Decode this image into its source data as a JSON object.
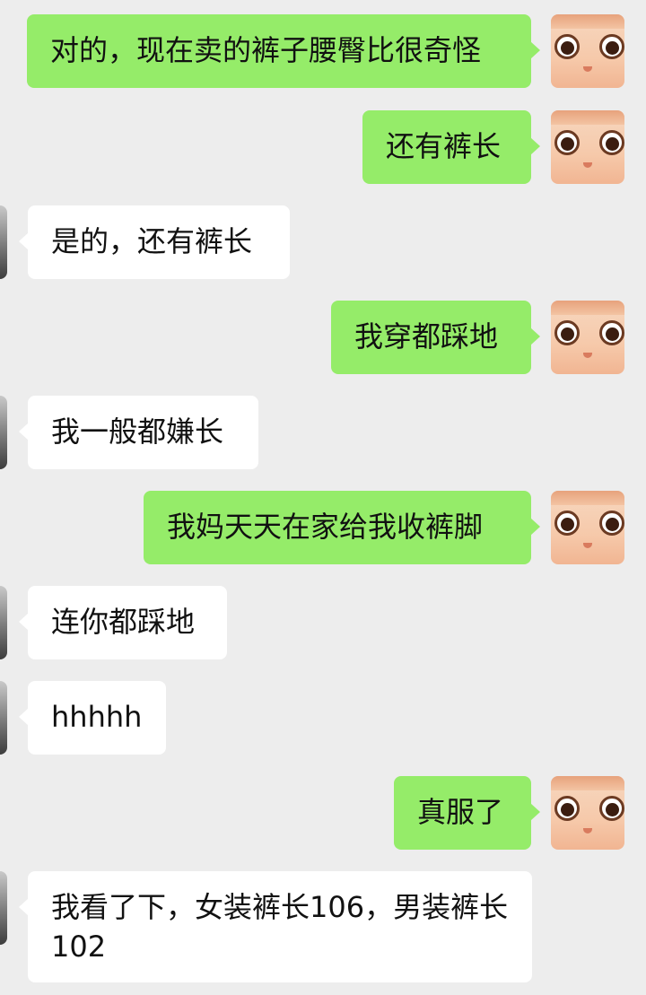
{
  "chat": {
    "messages": [
      {
        "side": "me",
        "text": "对的，现在卖的裤子腰臀比很奇怪"
      },
      {
        "side": "me",
        "text": "还有裤长"
      },
      {
        "side": "them",
        "text": "是的，还有裤长"
      },
      {
        "side": "me",
        "text": "我穿都踩地"
      },
      {
        "side": "them",
        "text": "我一般都嫌长"
      },
      {
        "side": "me",
        "text": "我妈天天在家给我收裤脚"
      },
      {
        "side": "them",
        "text": "连你都踩地"
      },
      {
        "side": "them",
        "text": "hhhhh"
      },
      {
        "side": "me",
        "text": "真服了"
      },
      {
        "side": "them",
        "text": "我看了下，女装裤长106，男装裤长102"
      }
    ]
  },
  "colors": {
    "background": "#ededed",
    "me_bubble": "#95ec69",
    "them_bubble": "#ffffff"
  },
  "icons": {
    "me_avatar": "cartoon-face-avatar-icon",
    "them_avatar": "contact-avatar-icon"
  }
}
